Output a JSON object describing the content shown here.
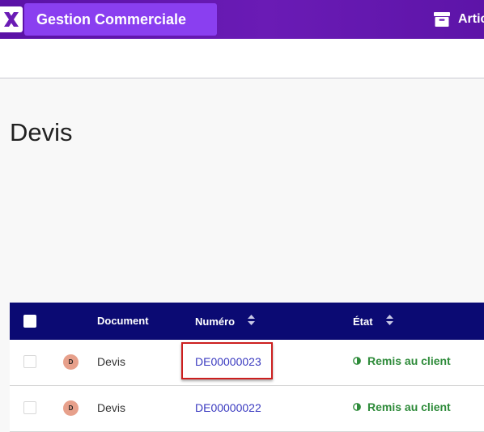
{
  "header": {
    "app_title": "Gestion Commerciale",
    "nav_articles_label": "Artic",
    "logo_letter": "X"
  },
  "page": {
    "title": "Devis"
  },
  "table": {
    "columns": {
      "document": "Document",
      "numero": "Numéro",
      "etat": "État"
    },
    "rows": [
      {
        "avatar": "D",
        "document": "Devis",
        "numero": "DE00000023",
        "etat": "Remis au client"
      },
      {
        "avatar": "D",
        "document": "Devis",
        "numero": "DE00000022",
        "etat": "Remis au client"
      }
    ]
  },
  "colors": {
    "header_bg": "#5a12a6",
    "app_title_bg": "#8a3ff0",
    "table_header_bg": "#0b0a73",
    "link": "#3a3ac0",
    "status_green": "#2e8b3a",
    "avatar_bg": "#e7a08b",
    "highlight": "#cc1f1f"
  },
  "icons": {
    "logo": "x-logo-icon",
    "articles": "archive-box-icon",
    "sort": "sort-arrows-icon",
    "status": "half-circle-icon"
  }
}
